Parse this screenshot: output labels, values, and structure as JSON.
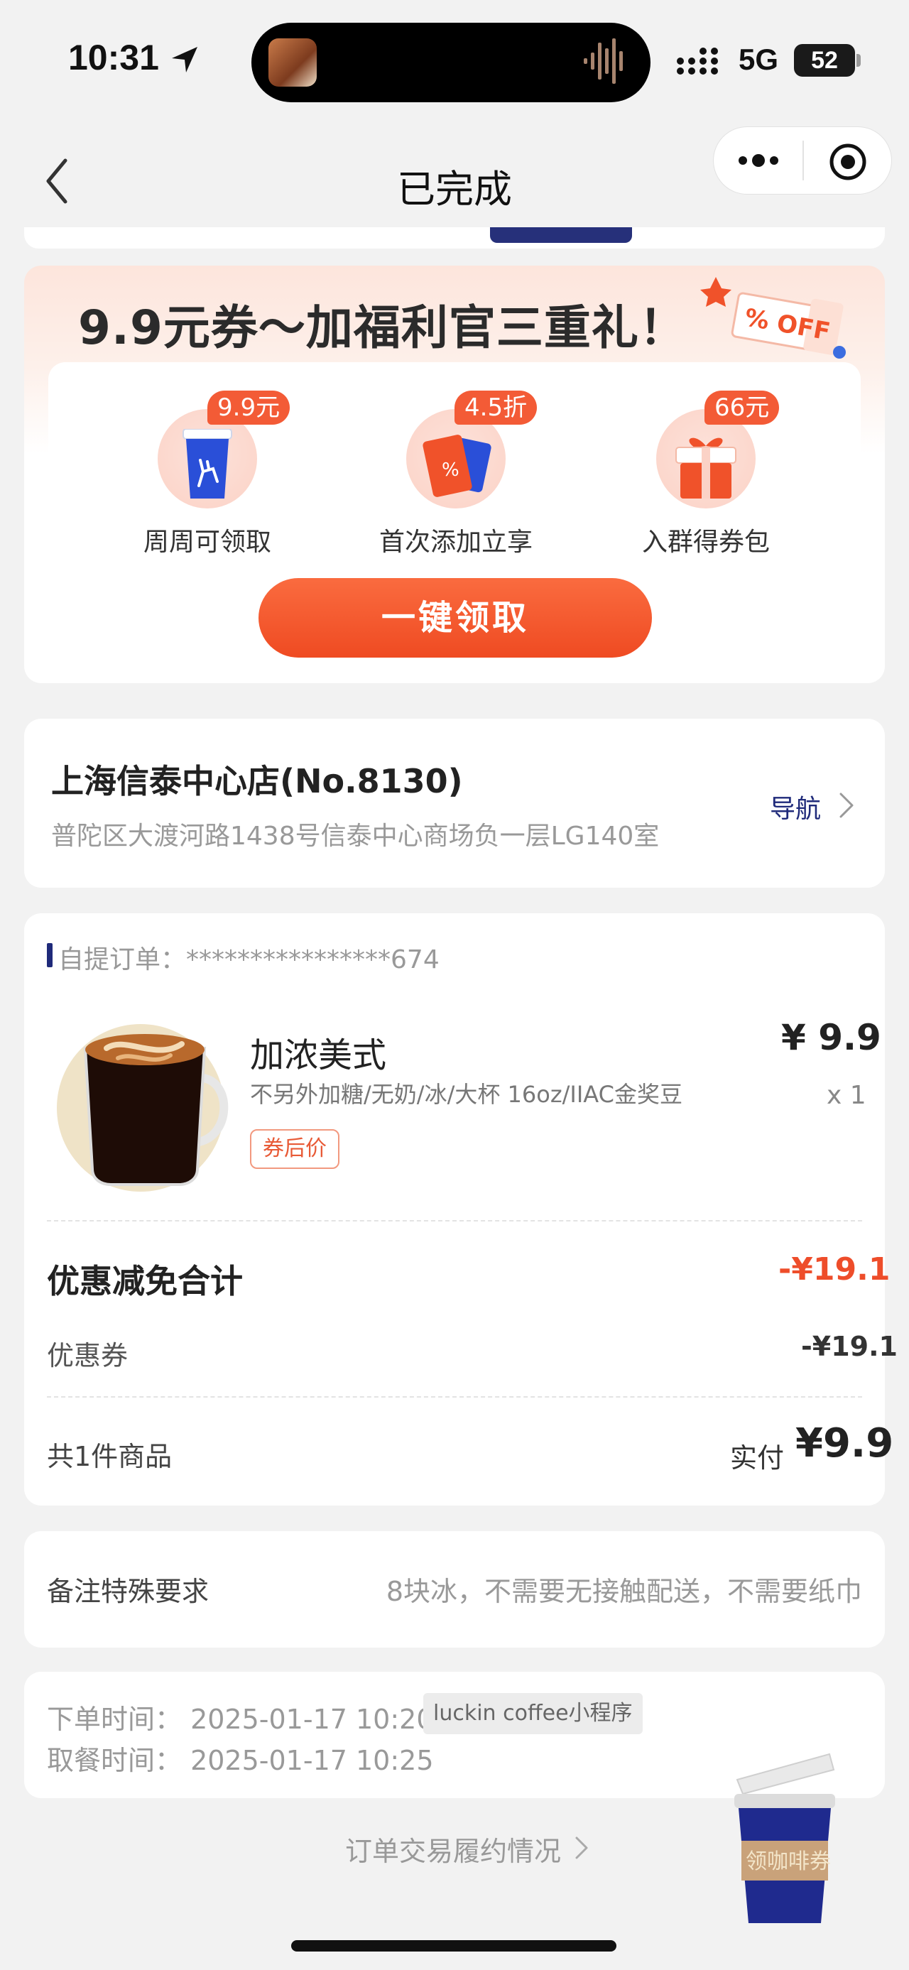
{
  "status_bar": {
    "time": "10:31",
    "network": "5G",
    "battery": "52"
  },
  "nav": {
    "title": "已完成"
  },
  "promo": {
    "title": "9.9元券～加福利官三重礼！",
    "ticket_text": "% OFF",
    "benefits": [
      {
        "tag": "9.9元",
        "label": "周周可领取",
        "icon": "coffee-cup-icon"
      },
      {
        "tag": "4.5折",
        "label": "首次添加立享",
        "icon": "coupon-tickets-icon"
      },
      {
        "tag": "66元",
        "label": "入群得券包",
        "icon": "gift-box-icon"
      }
    ],
    "button": "一键领取",
    "colors": {
      "accent": "#f0522a",
      "tag": "#f35b36"
    }
  },
  "store": {
    "name": "上海信泰中心店(No.8130)",
    "address": "普陀区大渡河路1438号信泰中心商场负一层LG140室",
    "nav_label": "导航"
  },
  "order": {
    "label": "自提订单：",
    "number": "****************674",
    "product": {
      "name": "加浓美式",
      "spec": "不另外加糖/无奶/冰/大杯 16oz/IIAC金奖豆",
      "price": "¥ 9.9",
      "qty": "x 1",
      "badge": "券后价"
    },
    "discount_title": "优惠减免合计",
    "discount_total": "-¥19.1",
    "coupon_label": "优惠券",
    "coupon_value": "-¥19.1",
    "count_label": "共1件商品",
    "paid_label": "实付",
    "paid_value": "¥9.9"
  },
  "remark": {
    "label": "备注特殊要求",
    "value": "8块冰，不需要无接触配送，不需要纸巾"
  },
  "times": {
    "order_time": "下单时间：  2025-01-17 10:20",
    "source": "luckin coffee小程序",
    "pickup_time": "取餐时间：  2025-01-17 10:25"
  },
  "footer": {
    "link": "订单交易履约情况"
  },
  "floating": {
    "label": "领咖啡券"
  },
  "brand_colors": {
    "navy": "#1f2a7a",
    "red": "#ee4d2a"
  }
}
